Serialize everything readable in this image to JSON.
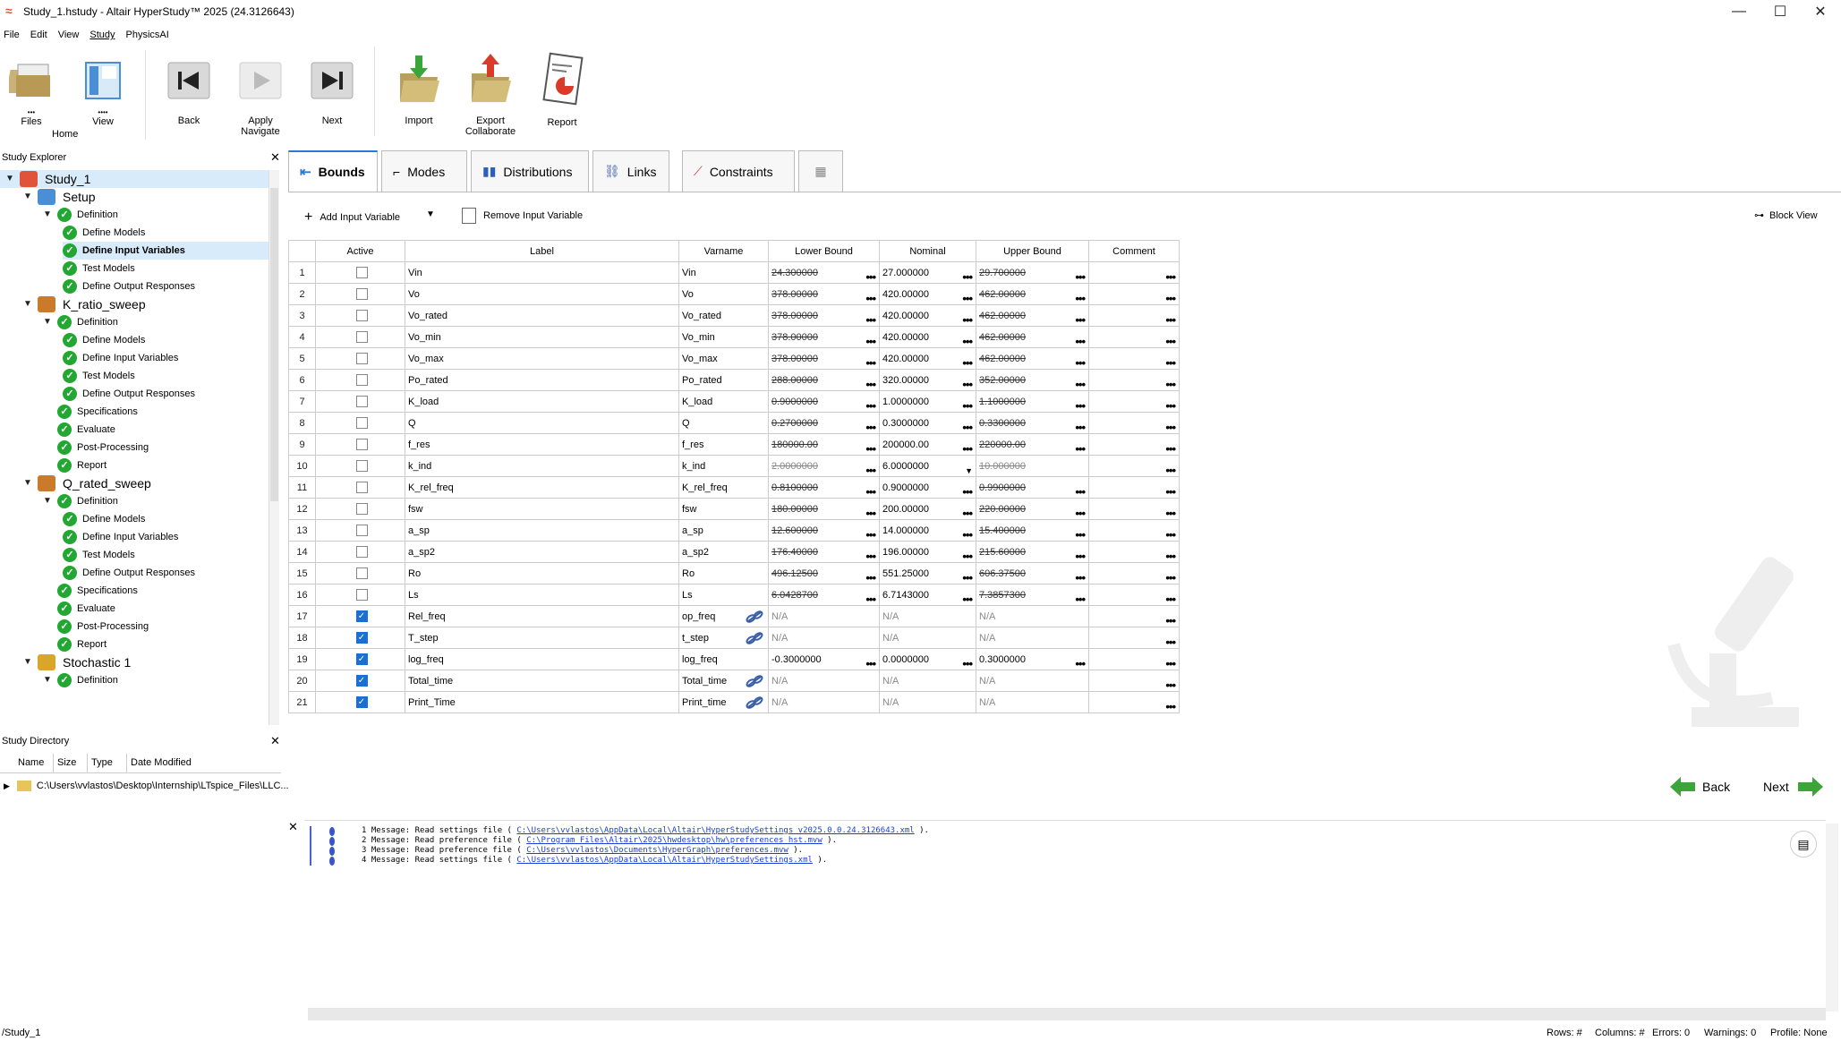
{
  "window": {
    "title": "Study_1.hstudy - Altair HyperStudy™ 2025 (24.3126643)"
  },
  "menu": [
    "File",
    "Edit",
    "View",
    "Study",
    "PhysicsAI"
  ],
  "ribbon": {
    "files": "Files",
    "view": "View",
    "home": "Home",
    "back": "Back",
    "apply": "Apply",
    "navigate": "Navigate",
    "next": "Next",
    "import": "Import",
    "export": "Export",
    "collaborate": "Collaborate",
    "report": "Report"
  },
  "explorer": {
    "title": "Study Explorer",
    "tree": [
      {
        "label": "Study_1",
        "level": 0,
        "icon": "study"
      },
      {
        "label": "Setup",
        "level": 1,
        "icon": "setup"
      },
      {
        "label": "Definition",
        "level": 2,
        "icon": "check"
      },
      {
        "label": "Define Models",
        "level": 3,
        "icon": "check"
      },
      {
        "label": "Define Input Variables",
        "level": 3,
        "icon": "check",
        "selected": true
      },
      {
        "label": "Test Models",
        "level": 3,
        "icon": "check"
      },
      {
        "label": "Define Output Responses",
        "level": 3,
        "icon": "check"
      },
      {
        "label": "K_ratio_sweep",
        "level": 1,
        "icon": "doe"
      },
      {
        "label": "Definition",
        "level": 2,
        "icon": "check"
      },
      {
        "label": "Define Models",
        "level": 3,
        "icon": "check"
      },
      {
        "label": "Define Input Variables",
        "level": 3,
        "icon": "check"
      },
      {
        "label": "Test Models",
        "level": 3,
        "icon": "check"
      },
      {
        "label": "Define Output Responses",
        "level": 3,
        "icon": "check"
      },
      {
        "label": "Specifications",
        "level": 2,
        "icon": "check"
      },
      {
        "label": "Evaluate",
        "level": 2,
        "icon": "check"
      },
      {
        "label": "Post-Processing",
        "level": 2,
        "icon": "check"
      },
      {
        "label": "Report",
        "level": 2,
        "icon": "check"
      },
      {
        "label": "Q_rated_sweep",
        "level": 1,
        "icon": "doe"
      },
      {
        "label": "Definition",
        "level": 2,
        "icon": "check"
      },
      {
        "label": "Define Models",
        "level": 3,
        "icon": "check"
      },
      {
        "label": "Define Input Variables",
        "level": 3,
        "icon": "check"
      },
      {
        "label": "Test Models",
        "level": 3,
        "icon": "check"
      },
      {
        "label": "Define Output Responses",
        "level": 3,
        "icon": "check"
      },
      {
        "label": "Specifications",
        "level": 2,
        "icon": "check"
      },
      {
        "label": "Evaluate",
        "level": 2,
        "icon": "check"
      },
      {
        "label": "Post-Processing",
        "level": 2,
        "icon": "check"
      },
      {
        "label": "Report",
        "level": 2,
        "icon": "check"
      },
      {
        "label": "Stochastic 1",
        "level": 1,
        "icon": "stoch"
      },
      {
        "label": "Definition",
        "level": 2,
        "icon": "check"
      }
    ]
  },
  "directory": {
    "title": "Study Directory",
    "columns": [
      "Name",
      "Size",
      "Type",
      "Date Modified"
    ],
    "path": "C:\\Users\\vvlastos\\Desktop\\Internship\\LTspice_Files\\LLC..."
  },
  "tabs": [
    "Bounds",
    "Modes",
    "Distributions",
    "Links",
    "Constraints"
  ],
  "toolbar": {
    "add": "Add Input Variable",
    "remove": "Remove Input Variable",
    "block_view": "Block View"
  },
  "table": {
    "columns": [
      "Active",
      "Label",
      "Varname",
      "Lower Bound",
      "Nominal",
      "Upper Bound",
      "Comment"
    ],
    "rows": [
      {
        "n": "1",
        "active": false,
        "label": "Vin",
        "var": "Vin",
        "lb": "24.300000",
        "nom": "27.000000",
        "ub": "29.700000",
        "st": "strike"
      },
      {
        "n": "2",
        "active": false,
        "label": "Vo",
        "var": "Vo",
        "lb": "378.00000",
        "nom": "420.00000",
        "ub": "462.00000",
        "st": "strike"
      },
      {
        "n": "3",
        "active": false,
        "label": "Vo_rated",
        "var": "Vo_rated",
        "lb": "378.00000",
        "nom": "420.00000",
        "ub": "462.00000",
        "st": "strike"
      },
      {
        "n": "4",
        "active": false,
        "label": "Vo_min",
        "var": "Vo_min",
        "lb": "378.00000",
        "nom": "420.00000",
        "ub": "462.00000",
        "st": "strike"
      },
      {
        "n": "5",
        "active": false,
        "label": "Vo_max",
        "var": "Vo_max",
        "lb": "378.00000",
        "nom": "420.00000",
        "ub": "462.00000",
        "st": "strike"
      },
      {
        "n": "6",
        "active": false,
        "label": "Po_rated",
        "var": "Po_rated",
        "lb": "288.00000",
        "nom": "320.00000",
        "ub": "352.00000",
        "st": "strike"
      },
      {
        "n": "7",
        "active": false,
        "label": "K_load",
        "var": "K_load",
        "lb": "0.9000000",
        "nom": "1.0000000",
        "ub": "1.1000000",
        "st": "strike"
      },
      {
        "n": "8",
        "active": false,
        "label": "Q",
        "var": "Q",
        "lb": "0.2700000",
        "nom": "0.3000000",
        "ub": "0.3300000",
        "st": "strike"
      },
      {
        "n": "9",
        "active": false,
        "label": "f_res",
        "var": "f_res",
        "lb": "180000.00",
        "nom": "200000.00",
        "ub": "220000.00",
        "st": "strike"
      },
      {
        "n": "10",
        "active": false,
        "label": "k_ind",
        "var": "k_ind",
        "lb": "2.0000000",
        "nom": "6.0000000",
        "ub": "10.000000",
        "st": "gray"
      },
      {
        "n": "11",
        "active": false,
        "label": "K_rel_freq",
        "var": "K_rel_freq",
        "lb": "0.8100000",
        "nom": "0.9000000",
        "ub": "0.9900000",
        "st": "strike"
      },
      {
        "n": "12",
        "active": false,
        "label": "fsw",
        "var": "fsw",
        "lb": "180.00000",
        "nom": "200.00000",
        "ub": "220.00000",
        "st": "strike"
      },
      {
        "n": "13",
        "active": false,
        "label": "a_sp",
        "var": "a_sp",
        "lb": "12.600000",
        "nom": "14.000000",
        "ub": "15.400000",
        "st": "strike"
      },
      {
        "n": "14",
        "active": false,
        "label": "a_sp2",
        "var": "a_sp2",
        "lb": "176.40000",
        "nom": "196.00000",
        "ub": "215.60000",
        "st": "strike"
      },
      {
        "n": "15",
        "active": false,
        "label": "Ro",
        "var": "Ro",
        "lb": "496.12500",
        "nom": "551.25000",
        "ub": "606.37500",
        "st": "strike"
      },
      {
        "n": "16",
        "active": false,
        "label": "Ls",
        "var": "Ls",
        "lb": "6.0428700",
        "nom": "6.7143000",
        "ub": "7.3857300",
        "st": "strike"
      },
      {
        "n": "17",
        "active": true,
        "label": "Rel_freq",
        "var": "op_freq",
        "lb": "N/A",
        "nom": "N/A",
        "ub": "N/A",
        "st": "na",
        "link": true
      },
      {
        "n": "18",
        "active": true,
        "label": "T_step",
        "var": "t_step",
        "lb": "N/A",
        "nom": "N/A",
        "ub": "N/A",
        "st": "na",
        "link": true
      },
      {
        "n": "19",
        "active": true,
        "label": "log_freq",
        "var": "log_freq",
        "lb": "-0.3000000",
        "nom": "0.0000000",
        "ub": "0.3000000",
        "st": "normal"
      },
      {
        "n": "20",
        "active": true,
        "label": "Total_time",
        "var": "Total_time",
        "lb": "N/A",
        "nom": "N/A",
        "ub": "N/A",
        "st": "na",
        "link": true
      },
      {
        "n": "21",
        "active": true,
        "label": "Print_Time",
        "var": "Print_time",
        "lb": "N/A",
        "nom": "N/A",
        "ub": "N/A",
        "st": "na",
        "link": true
      }
    ]
  },
  "nav": {
    "back": "Back",
    "next": "Next"
  },
  "messages": [
    {
      "prefix": "1 Message: Read settings file ( ",
      "path": "C:\\Users\\vvlastos\\AppData\\Local\\Altair\\HyperStudySettings_v2025.0.0.24.3126643.xml",
      "suffix": " )."
    },
    {
      "prefix": "2 Message: Read preference file ( ",
      "path": "C:\\Program Files\\Altair\\2025\\hwdesktop\\hw\\preferences_hst.mvw",
      "suffix": " )."
    },
    {
      "prefix": "3 Message: Read preference file ( ",
      "path": "C:\\Users\\vvlastos\\Documents\\HyperGraph\\preferences.mvw",
      "suffix": " )."
    },
    {
      "prefix": "4 Message: Read settings file ( ",
      "path": "C:\\Users\\vvlastos\\AppData\\Local\\Altair\\HyperStudySettings.xml",
      "suffix": " )."
    }
  ],
  "status": {
    "path": "/Study_1",
    "rows": "Rows: #",
    "columns": "Columns: #",
    "errors": "Errors: 0",
    "warnings": "Warnings: 0",
    "profile": "Profile: None"
  }
}
